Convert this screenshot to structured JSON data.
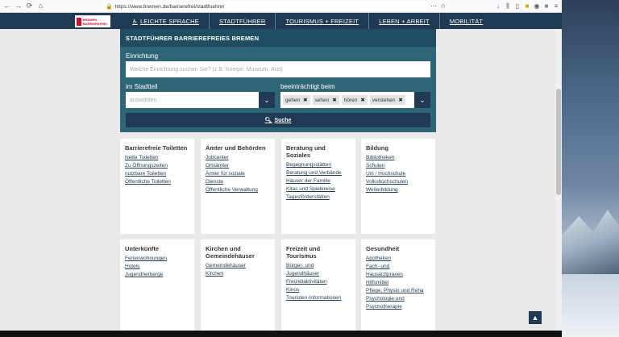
{
  "browser": {
    "url": "https://www.bremen.de/barrierefrei/stadtfuehrer",
    "back_icon": "←",
    "forward_icon": "→",
    "reload_icon": "⟳",
    "home_icon": "⌂",
    "menu_icon": "≡"
  },
  "header": {
    "logo_text": "BREMEN BARRIEREFREI",
    "nav": [
      {
        "label": "LEICHTE SPRACHE"
      },
      {
        "label": "STADTFÜHRER"
      },
      {
        "label": "TOURISMUS + FREIZEIT"
      },
      {
        "label": "LEBEN + ARBEIT"
      },
      {
        "label": "MOBILITÄT"
      }
    ]
  },
  "search": {
    "title": "STADTFÜHRER BARRIEREFREIES BREMEN",
    "einrichtung_label": "Einrichtung",
    "einrichtung_placeholder": "Welche Einrichtung suchen Sie? (z.B. Kneipe, Museum, Arzt)",
    "stadtteil_label": "im Stadtteil",
    "stadtteil_value": "auswählen",
    "beeintraechtigt_label": "beeinträchtigt beim",
    "tags": [
      "gehen",
      "sehen",
      "hören",
      "verstehen"
    ],
    "search_button": "Suche"
  },
  "categories": [
    {
      "title": "Barrierefreie Toiletten",
      "links": [
        "Nette Toiletten",
        "Zu Öffnungszeiten nutzbare Toiletten",
        "Öffentliche Toiletten"
      ]
    },
    {
      "title": "Ämter und Behörden",
      "links": [
        "Jobcenter",
        "Ortsämter",
        "Ämter für soziale Dienste",
        "Öffentliche Verwaltung"
      ]
    },
    {
      "title": "Beratung und Soziales",
      "links": [
        "Begegnungsstätten",
        "Beratung und Verbände",
        "Häuser der Familie",
        "Kitas und Spielkreise",
        "Tagesförderstätten"
      ]
    },
    {
      "title": "Bildung",
      "links": [
        "Bibliotheken",
        "Schulen",
        "Uni / Hochschule",
        "Volkshochschulen",
        "Weiterbildung"
      ]
    },
    {
      "title": "Unterkünfte",
      "links": [
        "Ferienwohnungen",
        "Hotels",
        "Jugendherberge"
      ]
    },
    {
      "title": "Kirchen und Gemeindehäuser",
      "links": [
        "Gemeindehäuser",
        "Kirchen"
      ]
    },
    {
      "title": "Freizeit und Tourismus",
      "links": [
        "Bürger- und Jugendhäuser",
        "Freizeitaktivitäten",
        "Kinos",
        "Touristen-Informationen"
      ]
    },
    {
      "title": "Gesundheit",
      "links": [
        "Apotheken",
        "Fach- und Hausarztpraxen",
        "Hilfsmittel",
        "Pflege, Physio und Reha",
        "Psychologie und Psychotherapie"
      ]
    }
  ]
}
